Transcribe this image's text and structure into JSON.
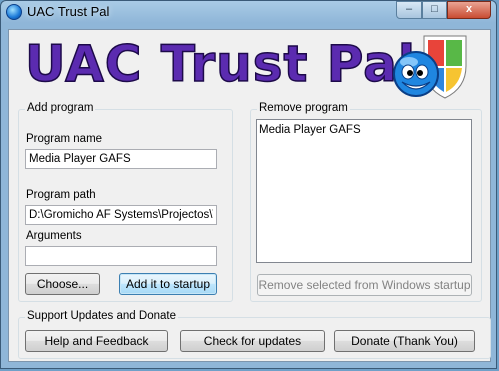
{
  "window": {
    "title": "UAC Trust Pal",
    "controls": {
      "minimize": "–",
      "maximize": "□",
      "close": "x"
    }
  },
  "logo": {
    "text": "UAC Trust Pal"
  },
  "add_program": {
    "group_label": "Add program",
    "name_label": "Program name",
    "name_value": "Media Player GAFS",
    "path_label": "Program path",
    "path_value": "D:\\Gromicho AF Systems\\Projectos\\Vis",
    "args_label": "Arguments",
    "args_value": "",
    "choose_button": "Choose...",
    "add_button": "Add it to startup"
  },
  "remove_program": {
    "group_label": "Remove program",
    "items": [
      "Media Player GAFS"
    ],
    "remove_button": "Remove selected from Windows startup"
  },
  "support": {
    "group_label": "Support Updates and Donate",
    "help_button": "Help and Feedback",
    "updates_button": "Check for updates",
    "donate_button": "Donate (Thank You)"
  }
}
